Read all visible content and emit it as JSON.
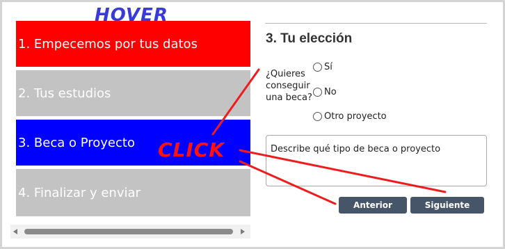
{
  "steps": [
    {
      "label": "1. Empecemos por tus datos",
      "color": "#ff0000"
    },
    {
      "label": "2. Tus estudios",
      "color": "#c3c3c3"
    },
    {
      "label": "3. Beca o Proyecto",
      "color": "#0000ff"
    },
    {
      "label": "4. Finalizar y enviar",
      "color": "#c3c3c3"
    }
  ],
  "annotations": {
    "hover": "HOVER",
    "click": "CLICK",
    "arrow_color": "#ee1c1c"
  },
  "form": {
    "title": "3. Tu elección",
    "question": "¿Quieres conseguir una beca?",
    "options": [
      "Sí",
      "No",
      "Otro proyecto"
    ],
    "textarea_placeholder": "Describe qué tipo de beca o proyecto"
  },
  "buttons": {
    "prev": "Anterior",
    "next": "Siguiente",
    "color": "#465668"
  }
}
